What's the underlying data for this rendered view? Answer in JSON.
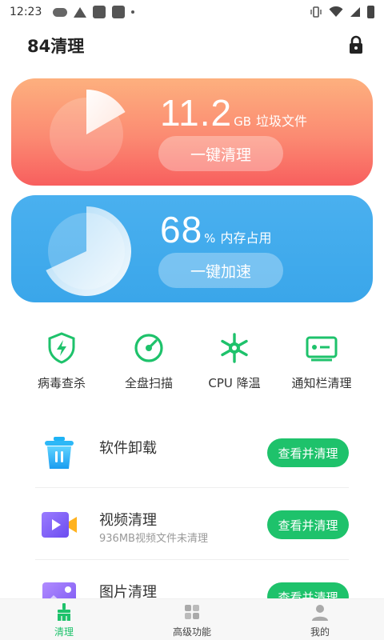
{
  "status_bar": {
    "time": "12:23"
  },
  "app": {
    "title": "84清理"
  },
  "cards": {
    "trash": {
      "value": "11.2",
      "unit": "GB",
      "label": "垃圾文件",
      "button": "一键清理"
    },
    "memory": {
      "value": "68",
      "unit": "%",
      "label": "内存占用",
      "button": "一键加速",
      "percent": 68
    }
  },
  "tools": [
    {
      "label": "病毒查杀",
      "icon": "shield-bolt-icon"
    },
    {
      "label": "全盘扫描",
      "icon": "scan-gauge-icon"
    },
    {
      "label": "CPU 降温",
      "icon": "snowflake-icon"
    },
    {
      "label": "通知栏清理",
      "icon": "notification-card-icon"
    }
  ],
  "list": [
    {
      "title": "软件卸载",
      "subtitle": "",
      "button": "查看并清理",
      "icon": "trash-bin-icon"
    },
    {
      "title": "视频清理",
      "subtitle": "936MB视频文件未清理",
      "button": "查看并清理",
      "icon": "video-icon"
    },
    {
      "title": "图片清理",
      "subtitle": "",
      "button": "查看并清理",
      "icon": "image-icon"
    }
  ],
  "bottom_nav": [
    {
      "label": "清理",
      "icon": "broom-icon",
      "active": true
    },
    {
      "label": "高级功能",
      "icon": "grid-icon",
      "active": false
    },
    {
      "label": "我的",
      "icon": "user-icon",
      "active": false
    }
  ],
  "colors": {
    "accent_green": "#1ec26b",
    "trash_card_top": "#fdb07e",
    "trash_card_bottom": "#f85f5e",
    "memory_card": "#3aa6ea"
  }
}
